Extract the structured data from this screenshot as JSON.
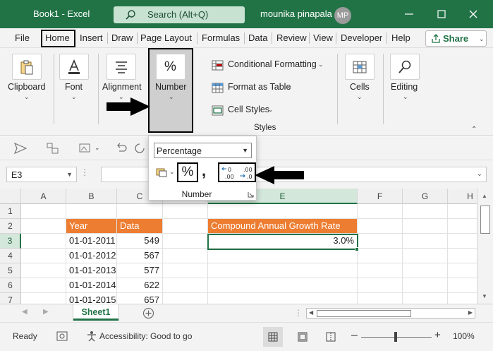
{
  "titlebar": {
    "doc_title": "Book1  -  Excel",
    "search_placeholder": "Search (Alt+Q)",
    "user_name": "mounika pinapala",
    "user_initials": "MP"
  },
  "tabs": [
    "File",
    "Home",
    "Insert",
    "Draw",
    "Page Layout",
    "Formulas",
    "Data",
    "Review",
    "View",
    "Developer",
    "Help"
  ],
  "share_label": "Share",
  "ribbon": {
    "clipboard": "Clipboard",
    "font": "Font",
    "alignment": "Alignment",
    "number": "Number",
    "conditional_formatting": "Conditional Formatting",
    "format_as_table": "Format as Table",
    "cell_styles": "Cell Styles",
    "styles_group": "Styles",
    "cells": "Cells",
    "editing": "Editing"
  },
  "formula_bar": {
    "name_box": "E3",
    "formula": ""
  },
  "grid": {
    "columns": [
      "A",
      "B",
      "C",
      "D",
      "E",
      "F",
      "G",
      "H"
    ],
    "rows": [
      "1",
      "2",
      "3",
      "4",
      "5",
      "6",
      "7"
    ],
    "header_year": "Year",
    "header_data": "Data",
    "header_cagr": "Compound Annual Growth Rate",
    "dates": [
      "01-01-2011",
      "01-01-2012",
      "01-01-2013",
      "01-01-2014",
      "01-01-2015"
    ],
    "values": [
      "549",
      "567",
      "577",
      "622",
      "657"
    ],
    "cagr_value": "3.0%"
  },
  "sheet_tab": "Sheet1",
  "status": {
    "ready": "Ready",
    "accessibility": "Accessibility: Good to go",
    "zoom": "100%"
  },
  "popup": {
    "format_value": "Percentage",
    "percent_symbol": "%",
    "comma_symbol": ",",
    "group_label": "Number"
  },
  "colors": {
    "excel_green": "#217346",
    "header_orange": "#ed7d31"
  }
}
